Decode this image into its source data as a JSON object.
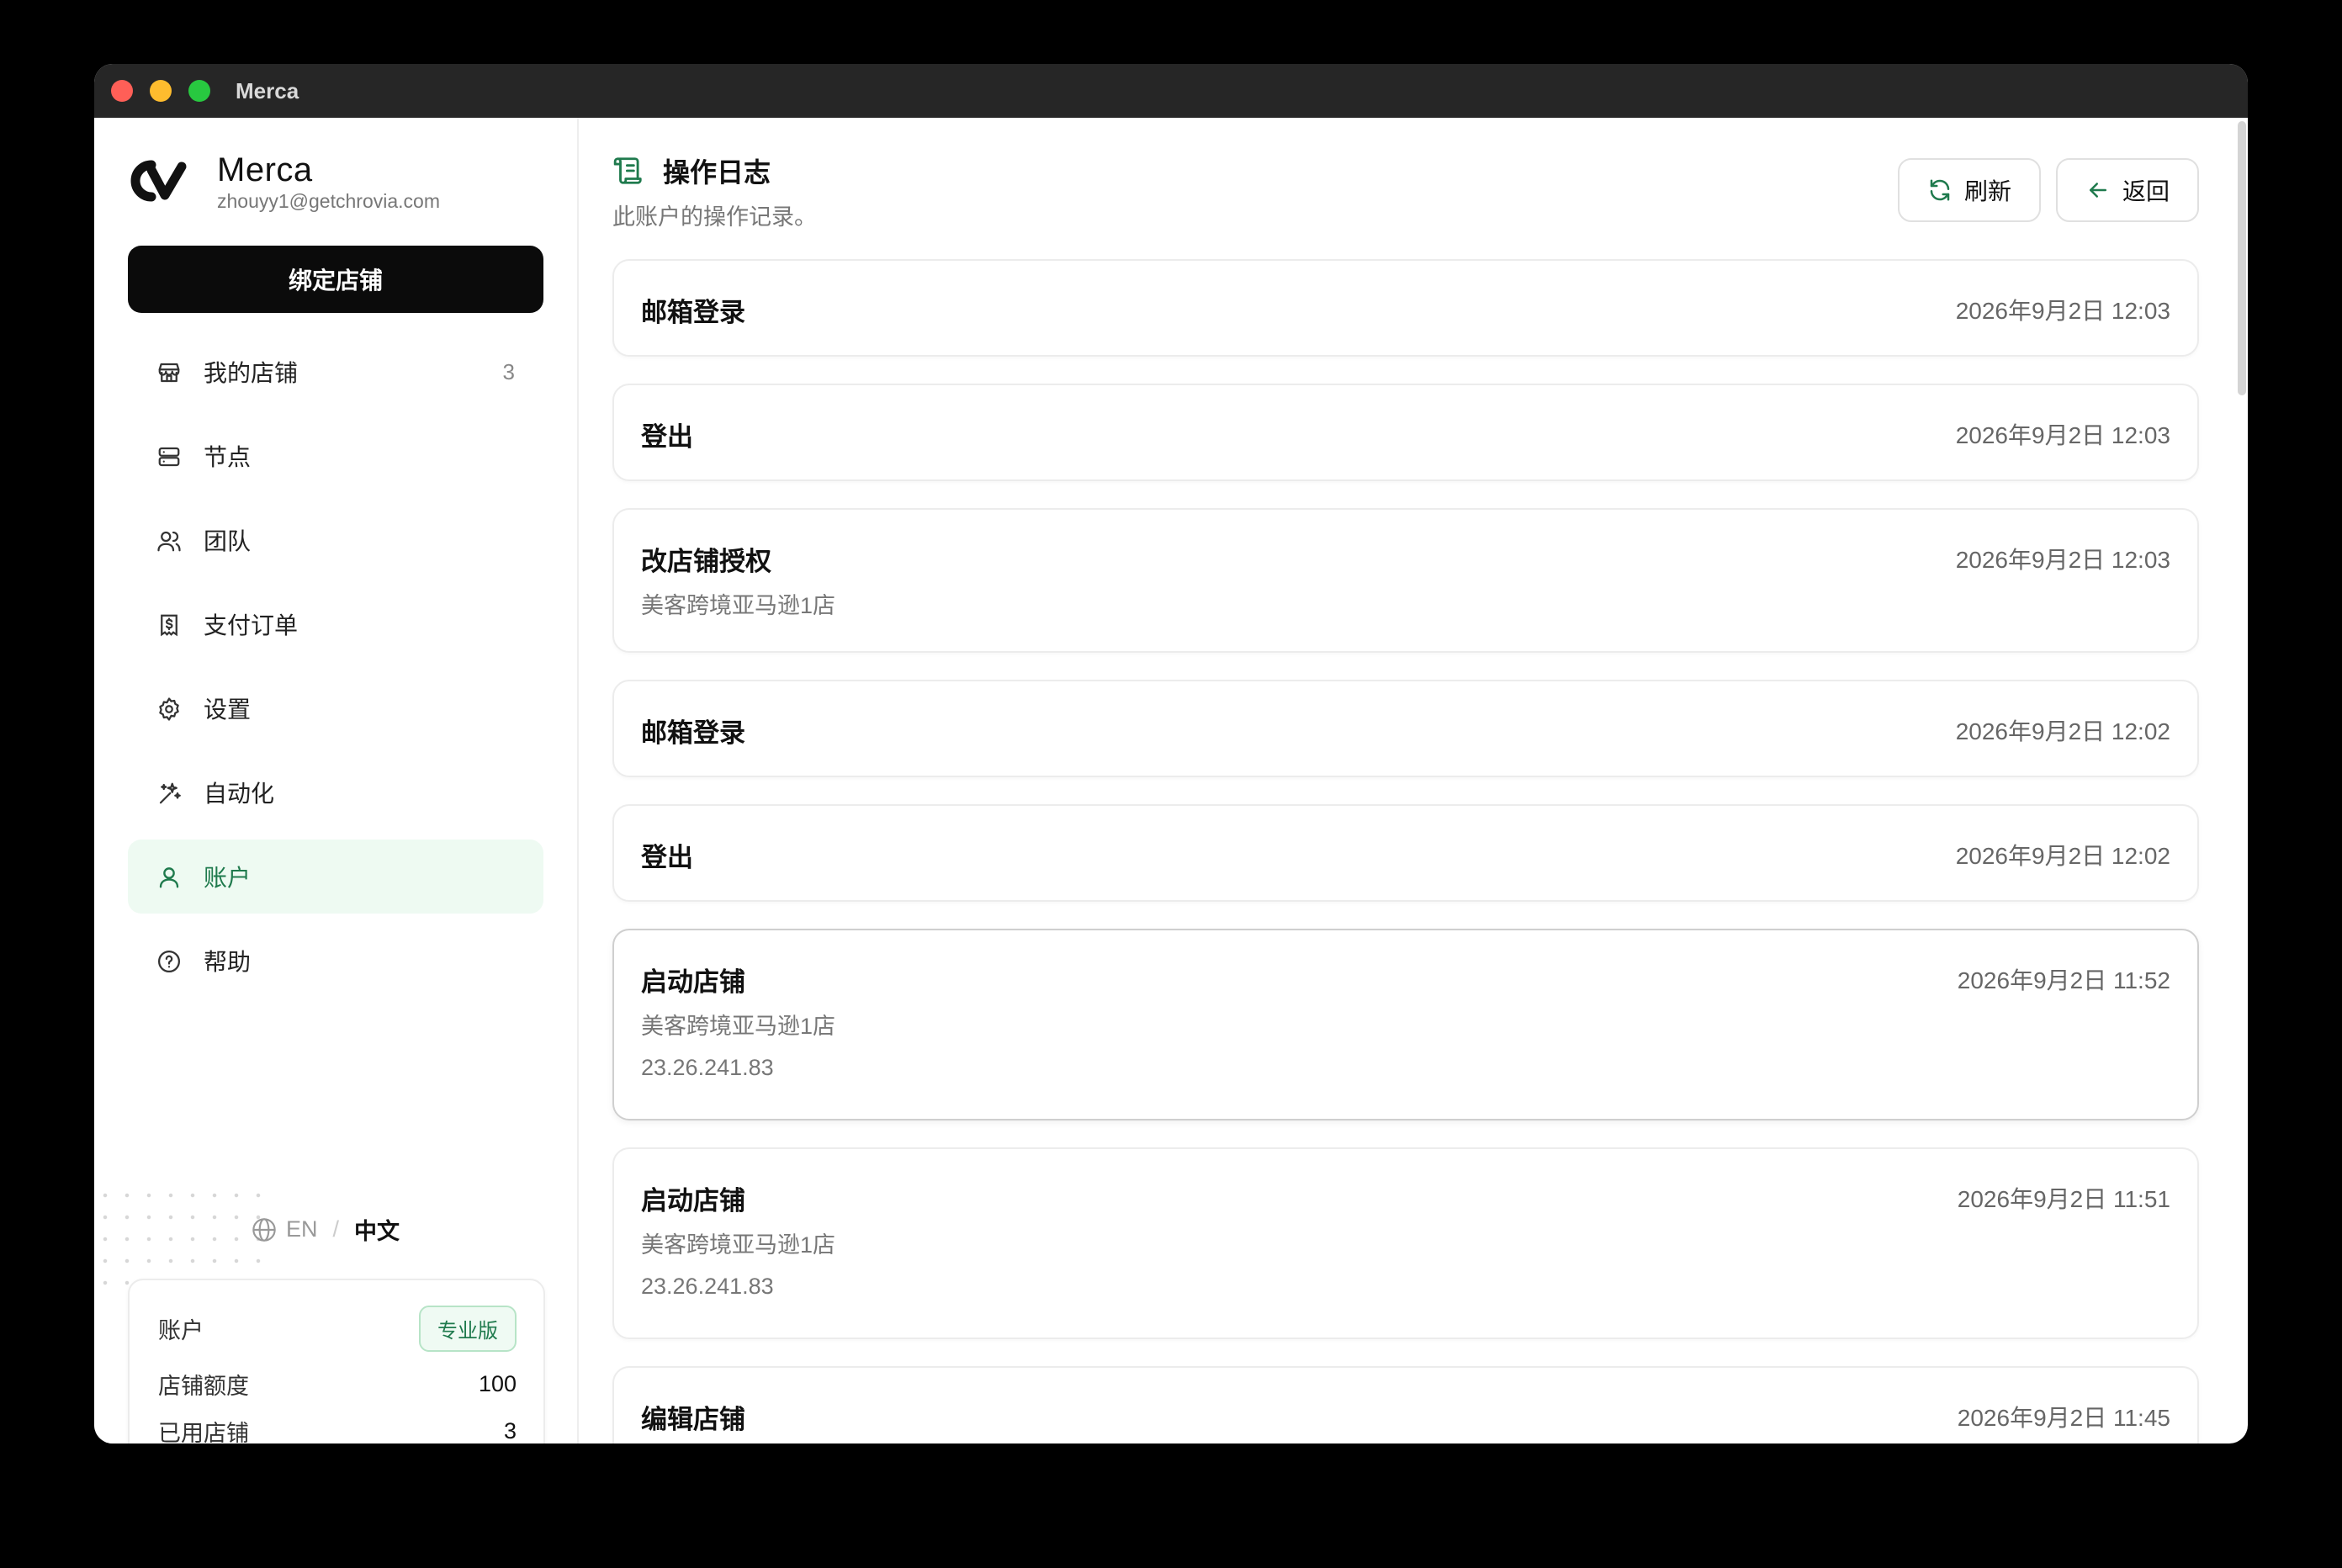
{
  "window": {
    "title": "Merca"
  },
  "brand": {
    "name": "Merca",
    "email": "zhouyy1@getchrovia.com"
  },
  "sidebar": {
    "bind_button": "绑定店铺",
    "items": [
      {
        "label": "我的店铺",
        "icon": "store-icon",
        "count": "3"
      },
      {
        "label": "节点",
        "icon": "server-icon",
        "count": ""
      },
      {
        "label": "团队",
        "icon": "users-icon",
        "count": ""
      },
      {
        "label": "支付订单",
        "icon": "receipt-icon",
        "count": ""
      },
      {
        "label": "设置",
        "icon": "gear-icon",
        "count": ""
      },
      {
        "label": "自动化",
        "icon": "sparkles-icon",
        "count": ""
      },
      {
        "label": "账户",
        "icon": "user-icon",
        "count": "",
        "active": true
      },
      {
        "label": "帮助",
        "icon": "help-icon",
        "count": ""
      }
    ]
  },
  "lang": {
    "en": "EN",
    "sep": "/",
    "zh": "中文"
  },
  "account": {
    "label": "账户",
    "plan": "专业版",
    "quota_label": "店铺额度",
    "quota_value": "100",
    "used_label": "已用店铺",
    "used_value": "3"
  },
  "header": {
    "title": "操作日志",
    "subtitle": "此账户的操作记录。",
    "refresh": "刷新",
    "back": "返回"
  },
  "logs": [
    {
      "title": "邮箱登录",
      "time": "2026年9月2日 12:03",
      "line1": "",
      "line2": ""
    },
    {
      "title": "登出",
      "time": "2026年9月2日 12:03",
      "line1": "",
      "line2": ""
    },
    {
      "title": "改店铺授权",
      "time": "2026年9月2日 12:03",
      "line1": "美客跨境亚马逊1店",
      "line2": ""
    },
    {
      "title": "邮箱登录",
      "time": "2026年9月2日 12:02",
      "line1": "",
      "line2": ""
    },
    {
      "title": "登出",
      "time": "2026年9月2日 12:02",
      "line1": "",
      "line2": ""
    },
    {
      "title": "启动店铺",
      "time": "2026年9月2日 11:52",
      "line1": "美客跨境亚马逊1店",
      "line2": "23.26.241.83"
    },
    {
      "title": "启动店铺",
      "time": "2026年9月2日 11:51",
      "line1": "美客跨境亚马逊1店",
      "line2": "23.26.241.83"
    },
    {
      "title": "编辑店铺",
      "time": "2026年9月2日 11:45",
      "line1": "",
      "line2": ""
    }
  ],
  "colors": {
    "accent": "#1f7a4d",
    "active_bg": "#eefaf2"
  }
}
